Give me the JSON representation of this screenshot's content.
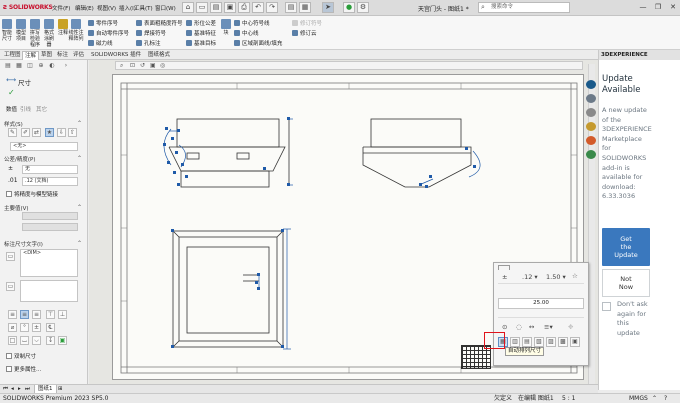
{
  "app": {
    "logo_text": "SOLIDWORKS",
    "menu": [
      "文件(F)",
      "编辑(E)",
      "视图(V)",
      "插入(I)",
      "工具(T)",
      "窗口(W)"
    ],
    "doc_title": "天宫门头 - 图纸1 *",
    "search_placeholder": "搜索命令",
    "window_controls": [
      "—",
      "❐",
      "✕"
    ]
  },
  "ribbon": {
    "big_buttons": [
      "智能尺寸",
      "模型项目",
      "拼写检验程序",
      "格式涂刷器",
      "注释",
      "线性注释阵列"
    ],
    "col1": [
      "零件序号",
      "自动零件序号",
      "磁力线"
    ],
    "col2": [
      "表面粗糙度符号",
      "焊接符号",
      "孔标注"
    ],
    "col3": [
      "形位公差",
      "基准特征",
      "基准目标"
    ],
    "col4_big": "块",
    "col5": [
      "中心符号线",
      "中心线",
      "区域剖面线/填充"
    ],
    "col6": [
      "修订符号",
      "修订云"
    ]
  },
  "cmdtabs": [
    "工程图",
    "注解",
    "草图",
    "标注",
    "评估",
    "SOLIDWORKS 插件",
    "图纸格式"
  ],
  "active_cmdtab": 1,
  "property_manager": {
    "title": "尺寸",
    "subtabs": [
      "数值",
      "引线",
      "其它"
    ],
    "style_label": "样式(S)",
    "style_value": "<无>",
    "tolerance_label": "公差/精度(P)",
    "tolerance_value": "无",
    "precision_value": ".12 (文档)",
    "link_to_model": "将精度与模型链接",
    "primary_value_label": "主要值(V)",
    "dim_text_label": "标注尺寸文字(I)",
    "dim_text_value": "<DIM>",
    "dual_dim_label": "双制尺寸",
    "more_label": "更多属性..."
  },
  "palette": {
    "value": "25.00",
    "tooltip": "自动排列尺寸"
  },
  "experience_panel": {
    "header": "3DEXPERIENCE",
    "title_lines": [
      "Update",
      "Available"
    ],
    "body_lines": [
      "A new update",
      "of the",
      "3DEXPERIENCE",
      "Marketplace",
      "for",
      "SOLIDWORKS",
      "add-in is",
      "available for",
      "download:",
      "6.33.3036"
    ],
    "get_update_lines": [
      "Get",
      "the",
      "Update"
    ],
    "not_now_lines": [
      "Not",
      "Now"
    ],
    "dont_ask_lines": [
      "Don't ask",
      "again for",
      "this",
      "update"
    ]
  },
  "sheet_tabs": [
    "图纸1"
  ],
  "status": {
    "left": "SOLIDWORKS Premium 2023 SP5.0",
    "state1": "欠定义",
    "state2": "在编辑 图纸1",
    "scale": "5 : 1",
    "units": "MMGS"
  },
  "colors": {
    "accent": "#3a78be",
    "highlight": "#e0141c",
    "selection": "#1f5aa8"
  }
}
